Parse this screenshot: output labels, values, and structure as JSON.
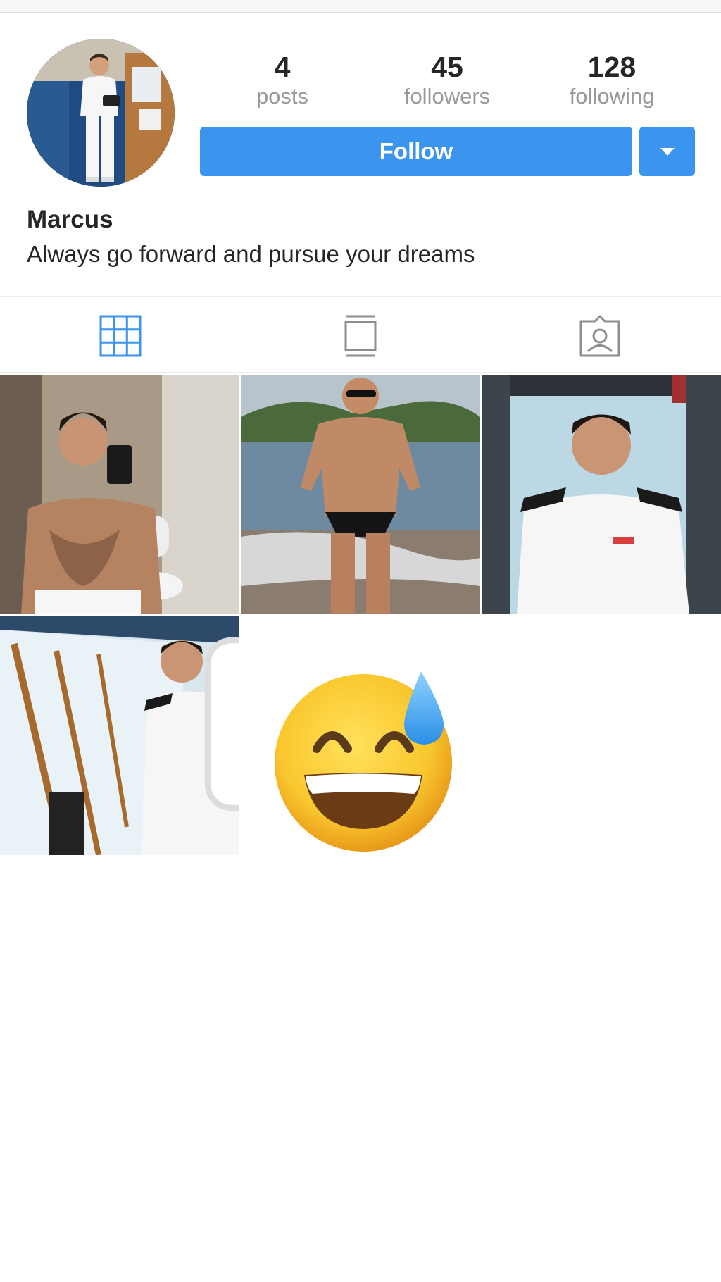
{
  "profile": {
    "name": "Marcus",
    "bio": "Always go forward and pursue your dreams"
  },
  "stats": [
    {
      "value": "4",
      "label": "posts"
    },
    {
      "value": "45",
      "label": "followers"
    },
    {
      "value": "128",
      "label": "following"
    }
  ],
  "actions": {
    "follow_label": "Follow"
  },
  "tabs": [
    {
      "icon": "grid-icon",
      "active": true
    },
    {
      "icon": "feed-icon",
      "active": false
    },
    {
      "icon": "tagged-icon",
      "active": false
    }
  ],
  "colors": {
    "accent": "#3b94ee",
    "text": "#262626",
    "muted": "#999999"
  },
  "posts": [
    {
      "icon": "photo"
    },
    {
      "icon": "photo"
    },
    {
      "icon": "photo"
    },
    {
      "icon": "photo",
      "badge": "multiple-photos-icon"
    }
  ],
  "overlay": {
    "emoji": "grinning-face-with-sweat-emoji"
  }
}
